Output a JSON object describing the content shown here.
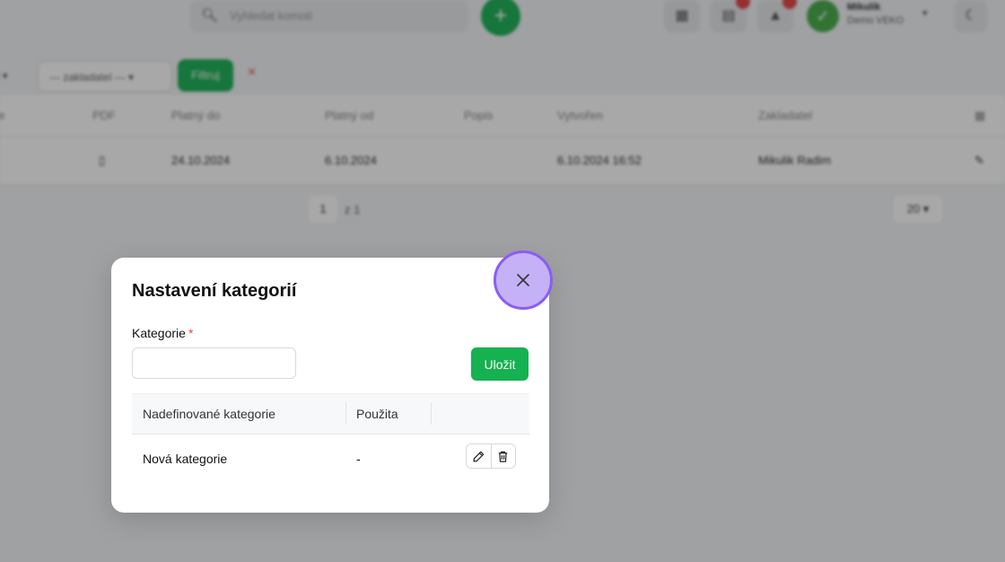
{
  "topbar": {
    "search_placeholder": "Vyhledat komoti",
    "plus_symbol": "+",
    "user_name": "Mikulik",
    "user_sub": "Demo VEKO",
    "icons": [
      "calendar-icon",
      "clipboard-icon",
      "bell-icon",
      "moon-icon"
    ]
  },
  "filters": {
    "select1": "re ▾",
    "select2": "--- zakladatel --- ▾",
    "filter_button": "Filtruj",
    "clear_symbol": "×"
  },
  "grid": {
    "columns": [
      "re",
      "PDF",
      "Platný do",
      "Platný od",
      "Popis",
      "Vytvořen",
      "Zakladatel"
    ],
    "row": {
      "platny_do": "24.10.2024",
      "platny_od": "6.10.2024",
      "vytvoren": "6.10.2024 16:52",
      "zakladatel": "Mikulik Radim"
    }
  },
  "pager": {
    "page": "1",
    "of": "z 1",
    "page_size": "20 ▾"
  },
  "modal": {
    "title": "Nastavení kategorií",
    "field_label": "Kategorie",
    "required_mark": "*",
    "input_value": "",
    "save_label": "Uložit",
    "table": {
      "headers": [
        "Nadefinované kategorie",
        "Použita"
      ],
      "rows": [
        {
          "name": "Nová kategorie",
          "used": "-"
        }
      ]
    }
  },
  "colors": {
    "accent_green": "#16b150",
    "close_highlight": "#c4b1f6",
    "close_border": "#8b5cf6",
    "required_red": "#e5484d"
  }
}
